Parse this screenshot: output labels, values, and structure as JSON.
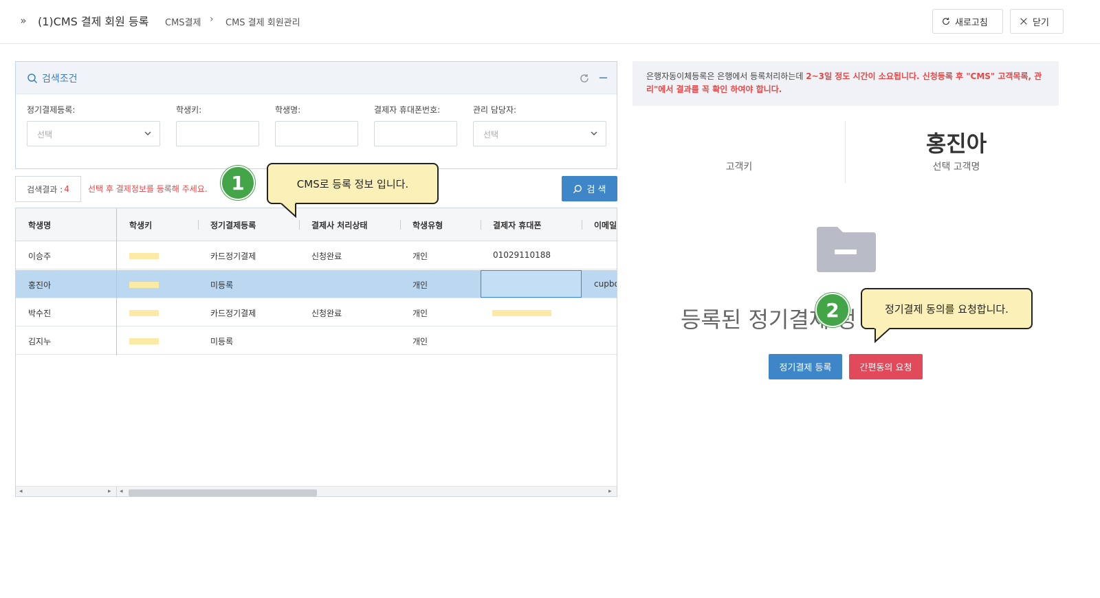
{
  "header": {
    "page_title": "(1)CMS 결제 회원 등록",
    "breadcrumb": [
      "CMS결제",
      "CMS 결제 회원관리"
    ],
    "refresh_label": "새로고침",
    "close_label": "닫기"
  },
  "search": {
    "title": "검색조건",
    "fields": [
      {
        "label": "정기결제등록:",
        "placeholder": "선택"
      },
      {
        "label": "학생키:",
        "placeholder": ""
      },
      {
        "label": "학생명:",
        "placeholder": ""
      },
      {
        "label": "결제자 휴대폰번호:",
        "placeholder": ""
      },
      {
        "label": "관리 담당자:",
        "placeholder": "선택"
      }
    ],
    "button_label": "검 색"
  },
  "results": {
    "label": "검색결과 :",
    "count": "4",
    "hint": "선택 후 결제정보를 등록해 주세요."
  },
  "grid": {
    "columns": [
      "학생명",
      "학생키",
      "정기결제등록",
      "결제사 처리상태",
      "학생유형",
      "결제자 휴대폰",
      "이메일"
    ],
    "rows": [
      {
        "name": "이승주",
        "reg": "카드정기결제",
        "status": "신청완료",
        "type": "개인",
        "phone": "01029110188",
        "email": ""
      },
      {
        "name": "홍진아",
        "reg": "미등록",
        "status": "",
        "type": "개인",
        "phone": "",
        "email": "cupbo"
      },
      {
        "name": "박수진",
        "reg": "카드정기결제",
        "status": "신청완료",
        "type": "개인",
        "phone": "",
        "email": ""
      },
      {
        "name": "김지누",
        "reg": "미등록",
        "status": "",
        "type": "개인",
        "phone": "",
        "email": ""
      }
    ]
  },
  "callouts": {
    "one": {
      "number": "1",
      "text": "CMS로 등록 정보 입니다."
    },
    "two": {
      "number": "2",
      "text": "정기결제 동의를 요청합니다."
    }
  },
  "right": {
    "notice_normal": "은행자동이체등록은 은행에서 등록처리하는데 ",
    "notice_red": "2~3일 정도 시간이 소요됩니다. 신청등록 후 \"CMS\" 고객목록, 관리\"에서 결과를 꼭 확인 하여야 합니다.",
    "customer_key_label": "고객키",
    "customer_name": "홍진아",
    "customer_name_label": "선택 고객명",
    "empty_text": "등록된 정기결제 정",
    "register_button": "정기결제 등록",
    "consent_button": "간편동의 요청"
  },
  "colors": {
    "accent": "#3f86c9",
    "danger": "#e54848",
    "badge": "#43a548",
    "bubble": "#fbf1b8"
  }
}
